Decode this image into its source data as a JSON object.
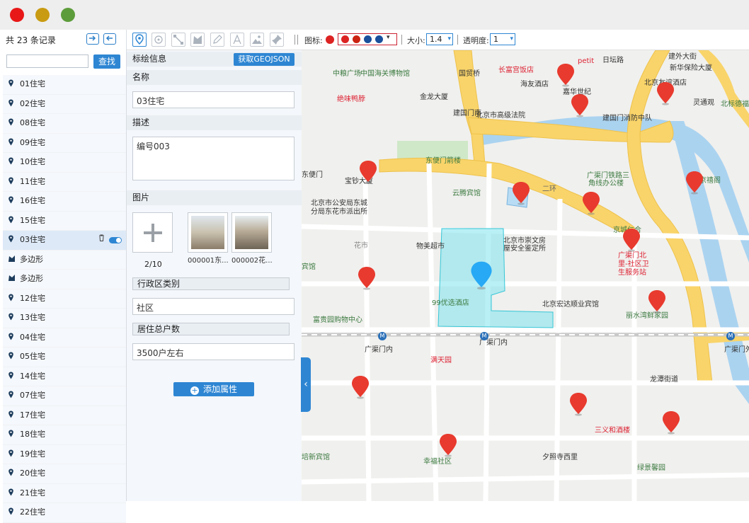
{
  "window": {
    "dots": [
      "#e81818",
      "#c99b12",
      "#5d9c3b"
    ]
  },
  "sidebar": {
    "count_label": "共 23 条记录",
    "search_placeholder": "",
    "search_button": "查找",
    "items": [
      {
        "label": "01住宅",
        "icon": "location-pin-icon"
      },
      {
        "label": "02住宅",
        "icon": "location-pin-icon"
      },
      {
        "label": "08住宅",
        "icon": "location-pin-icon"
      },
      {
        "label": "09住宅",
        "icon": "location-pin-icon"
      },
      {
        "label": "10住宅",
        "icon": "location-pin-icon"
      },
      {
        "label": "11住宅",
        "icon": "location-pin-icon"
      },
      {
        "label": "16住宅",
        "icon": "location-pin-icon"
      },
      {
        "label": "15住宅",
        "icon": "location-pin-icon"
      },
      {
        "label": "03住宅",
        "icon": "location-pin-icon",
        "selected": true
      },
      {
        "label": "多边形",
        "icon": "polygon-icon"
      },
      {
        "label": "多边形",
        "icon": "polygon-icon"
      },
      {
        "label": "12住宅",
        "icon": "location-pin-icon"
      },
      {
        "label": "13住宅",
        "icon": "location-pin-icon"
      },
      {
        "label": "04住宅",
        "icon": "location-pin-icon"
      },
      {
        "label": "05住宅",
        "icon": "location-pin-icon"
      },
      {
        "label": "14住宅",
        "icon": "location-pin-icon"
      },
      {
        "label": "07住宅",
        "icon": "location-pin-icon"
      },
      {
        "label": "17住宅",
        "icon": "location-pin-icon"
      },
      {
        "label": "18住宅",
        "icon": "location-pin-icon"
      },
      {
        "label": "19住宅",
        "icon": "location-pin-icon"
      },
      {
        "label": "20住宅",
        "icon": "location-pin-icon"
      },
      {
        "label": "21住宅",
        "icon": "location-pin-icon"
      },
      {
        "label": "22住宅",
        "icon": "location-pin-icon"
      }
    ]
  },
  "toolbar": {
    "icon_label": "图标:",
    "size_label": "大小:",
    "size_value": "1.4",
    "opacity_label": "透明度:",
    "opacity_value": "1",
    "tools": [
      "marker-tool-icon",
      "circle-tool-icon",
      "line-tool-icon",
      "polygon-tool-icon",
      "edit-tool-icon",
      "text-tool-icon",
      "image-tool-icon",
      "pin-tool-icon"
    ],
    "icon_swatches": [
      "#d22",
      "#c21",
      "#1a4f9c",
      "#1a4f9c"
    ]
  },
  "panel": {
    "header": "标绘信息",
    "get_geojson": "获取GEOJSON",
    "name_label": "名称",
    "name_value": "03住宅",
    "desc_label": "描述",
    "desc_value": "编号003",
    "image_label": "图片",
    "image_count": "2/10",
    "images": [
      {
        "caption": "000001东..."
      },
      {
        "caption": "000002花..."
      }
    ],
    "district_label": "行政区类别",
    "district_value": "社区",
    "households_label": "居住总户数",
    "households_value": "3500户左右",
    "add_property": "添加属性"
  },
  "map": {
    "labels": {
      "l1": "中粮广场",
      "l2": "中国海关博物馆",
      "l3": "国贸桥",
      "l4": "长富宫饭店",
      "l5": "海友酒店",
      "l6": "嘉华世纪",
      "l7": "日坛路",
      "l8": "建外大街",
      "l9": "新华保险大厦",
      "l10": "北京友谊酒店",
      "l11": "灵通观",
      "l12": "北京市高级法院",
      "l13": "建国门南",
      "l14": "金龙大厦",
      "l15": "绝味鸭脖",
      "l16": "建国门消防中队",
      "l17": "东便门箭楼",
      "l18": "东便门",
      "l19": "宝钞大厦",
      "l20": "云腾宾馆",
      "l21": "北京市公安局东城",
      "l22": "分局东花市派出所",
      "l23": "广渠门铁路三",
      "l24": "角线办公楼",
      "l25": "京禧阁",
      "l26": "京城仁合",
      "l27": "广渠门北",
      "l28": "里-社区卫",
      "l29": "生服务站",
      "l30": "花市",
      "l31": "物美超市",
      "l32": "北京市崇文房",
      "l33": "屋安全鉴定所",
      "l34": "99优选酒店",
      "l35": "北京宏达顺业宾馆",
      "l36": "丽水湾鲜家园",
      "l37": "富贵园购物中心",
      "l38": "广渠门内",
      "l39": "广渠门内",
      "l40": "满天园",
      "l41": "龙潭街道",
      "l42": "广渠门外",
      "l43": "三义和酒楼",
      "l44": "幸福社区",
      "l45": "夕照寺西里",
      "l46": "绿景馨园",
      "l47": "宾馆",
      "l48": "培新宾馆",
      "l49": "petit",
      "l50": "北标德福",
      "l51": "二环"
    },
    "station_letter": "M"
  }
}
